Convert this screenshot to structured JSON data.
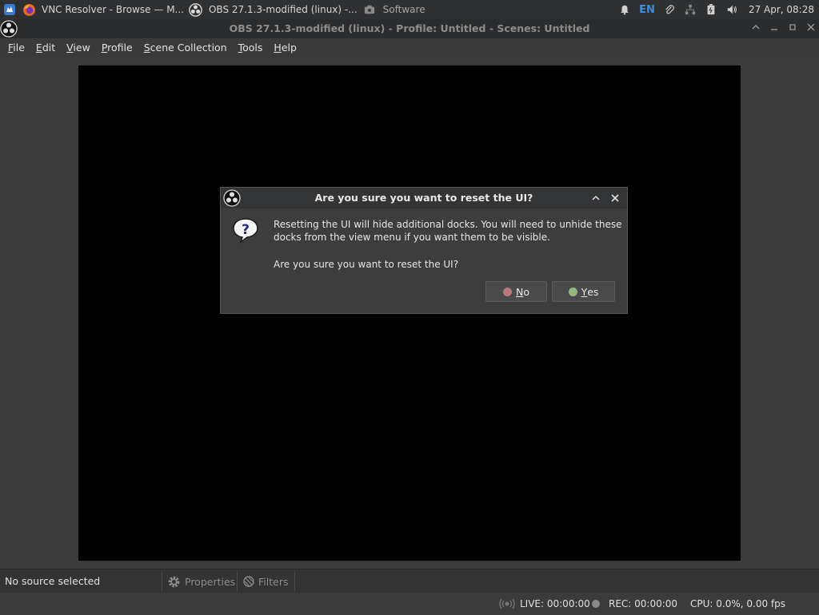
{
  "taskbar": {
    "tasks": [
      {
        "label": "VNC Resolver - Browse — M...",
        "icon": "firefox-icon"
      },
      {
        "label": "OBS 27.1.3-modified (linux) -...",
        "icon": "obs-icon"
      },
      {
        "label": "Software",
        "icon": "camera-icon"
      }
    ],
    "tray_lang": "EN",
    "clock": "27 Apr, 08:28"
  },
  "window": {
    "title": "OBS 27.1.3-modified (linux) - Profile: Untitled - Scenes: Untitled"
  },
  "menu": {
    "file": {
      "mn": "F",
      "rest": "ile"
    },
    "edit": {
      "mn": "E",
      "rest": "dit"
    },
    "view": {
      "mn": "V",
      "rest": "iew"
    },
    "profile": {
      "mn": "P",
      "rest": "rofile"
    },
    "scene_collection": {
      "mn": "S",
      "rest": "cene Collection"
    },
    "tools": {
      "mn": "T",
      "rest": "ools"
    },
    "help": {
      "mn": "H",
      "rest": "elp"
    }
  },
  "dialog": {
    "title": "Are you sure you want to reset the UI?",
    "line1": "Resetting the UI will hide additional docks. You will need to unhide these",
    "line2": "docks from the view menu if you want them to be visible.",
    "question": "Are you sure you want to reset the UI?",
    "no": {
      "mn": "N",
      "rest": "o"
    },
    "yes": {
      "mn": "Y",
      "rest": "es"
    }
  },
  "sources": {
    "no_source": "No source selected",
    "properties": "Properties",
    "filters": "Filters"
  },
  "status": {
    "live": "LIVE: 00:00:00",
    "rec": "REC: 00:00:00",
    "cpu": "CPU: 0.0%, 0.00 fps"
  },
  "colors": {
    "no_dot": "#b87878",
    "yes_dot": "#8fba7c"
  }
}
